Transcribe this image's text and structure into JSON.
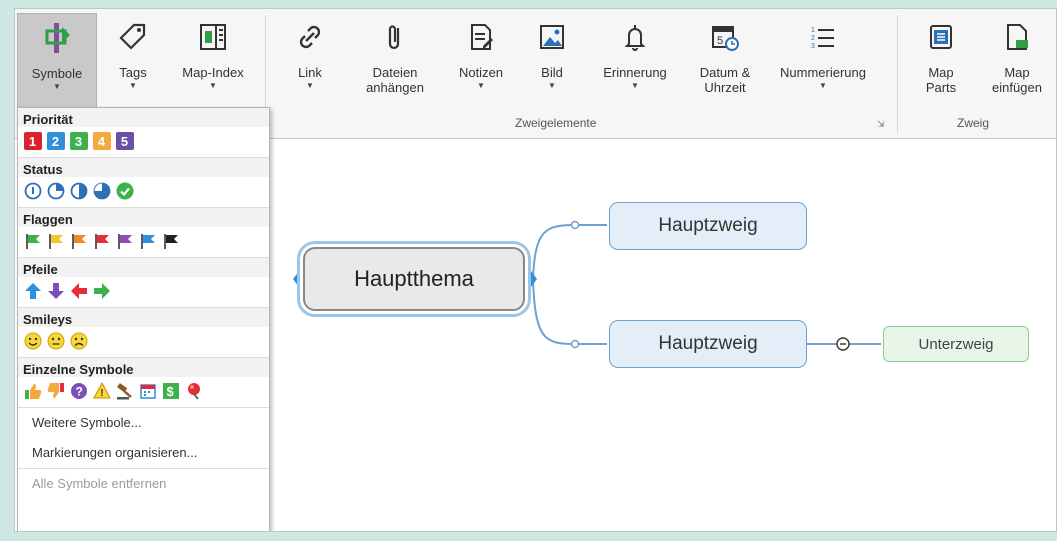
{
  "ribbon": {
    "buttons": {
      "symbole": "Symbole",
      "tags": "Tags",
      "mapindex": "Map-Index",
      "link": "Link",
      "dateien": "Dateien\nanhängen",
      "notizen": "Notizen",
      "bild": "Bild",
      "erinnerung": "Erinnerung",
      "datum": "Datum &\nUhrzeit",
      "nummerierung": "Nummerierung",
      "mapparts": "Map\nParts",
      "mapeinfuegen": "Map\neinfügen"
    },
    "groups": {
      "zweigelemente": "Zweigelemente",
      "zweig": "Zweig"
    },
    "icons": [
      "symbol-icon",
      "tag-icon",
      "map-index-icon",
      "link-icon",
      "paperclip-icon",
      "notes-icon",
      "image-icon",
      "bell-icon",
      "calendar-clock-icon",
      "numbered-list-icon",
      "map-parts-icon",
      "insert-map-icon"
    ]
  },
  "dropdown": {
    "sections": {
      "prioritaet": "Priorität",
      "status": "Status",
      "flaggen": "Flaggen",
      "pfeile": "Pfeile",
      "smileys": "Smileys",
      "einzelne": "Einzelne Symbole"
    },
    "priorities": [
      {
        "label": "1",
        "color": "#d9232e"
      },
      {
        "label": "2",
        "color": "#2f8fd9"
      },
      {
        "label": "3",
        "color": "#3db24b"
      },
      {
        "label": "4",
        "color": "#f3a93b"
      },
      {
        "label": "5",
        "color": "#6b4fa8"
      }
    ],
    "flag_colors": [
      "#3db24b",
      "#f5c52a",
      "#f08a24",
      "#e52d3a",
      "#8c4fb8",
      "#2f8fd9",
      "#222222"
    ],
    "items": {
      "weitere": "Weitere Symbole...",
      "markierungen": "Markierungen organisieren...",
      "entfernen": "Alle Symbole entfernen"
    }
  },
  "map": {
    "main_topic": "Hauptthema",
    "branch_1": "Hauptzweig",
    "branch_2": "Hauptzweig",
    "subtopic": "Unterzweig"
  },
  "colors": {
    "accent_blue": "#6ea0d0",
    "selection": "#9cc6e8"
  }
}
